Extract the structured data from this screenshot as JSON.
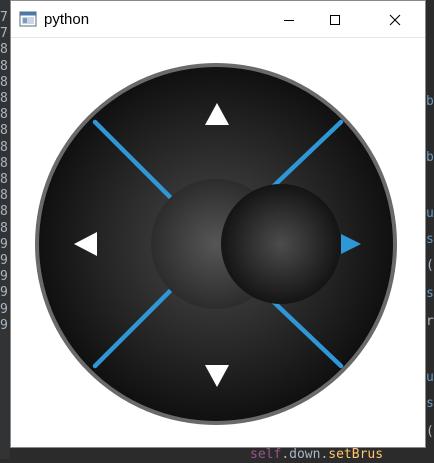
{
  "window": {
    "title": "python",
    "icon": "python-window-icon",
    "controls": [
      "minimize-icon",
      "maximize-icon",
      "close-icon"
    ]
  },
  "background_editor": {
    "gutter_lines": [
      "7",
      "7",
      "8",
      "8",
      "8",
      "8",
      "8",
      "8",
      "8",
      "8",
      "8",
      "8",
      "8",
      "8",
      "9",
      "9",
      "9",
      "9",
      "9",
      "9"
    ],
    "right_edge_fragments": [
      {
        "text": "b",
        "color": "#6897bb"
      },
      {
        "text": "b",
        "color": "#6897bb"
      },
      {
        "text": "u",
        "color": "#6897bb"
      },
      {
        "text": "s",
        "color": "#6897bb"
      },
      {
        "text": "(",
        "color": "#a9b7c6"
      },
      {
        "text": "s",
        "color": "#6897bb"
      },
      {
        "text": "r",
        "color": "#a9b7c6"
      },
      {
        "text": "u",
        "color": "#6897bb"
      },
      {
        "text": "s",
        "color": "#6897bb"
      },
      {
        "text": "(",
        "color": "#a9b7c6"
      }
    ],
    "bottom_fragment": {
      "self": "self",
      "dot1": ".",
      "down": "down",
      "dot2": ".",
      "method": "setBrus"
    }
  },
  "joystick": {
    "directions": [
      "up",
      "down",
      "left",
      "right"
    ],
    "active_direction": "right",
    "colors": {
      "ring": "#6a6a6a",
      "pad_center": "#4a4a4a",
      "pad_edge": "#101010",
      "diagonal": "#2f97d8",
      "arrow_default": "#ffffff",
      "arrow_active": "#2f97d8"
    }
  }
}
